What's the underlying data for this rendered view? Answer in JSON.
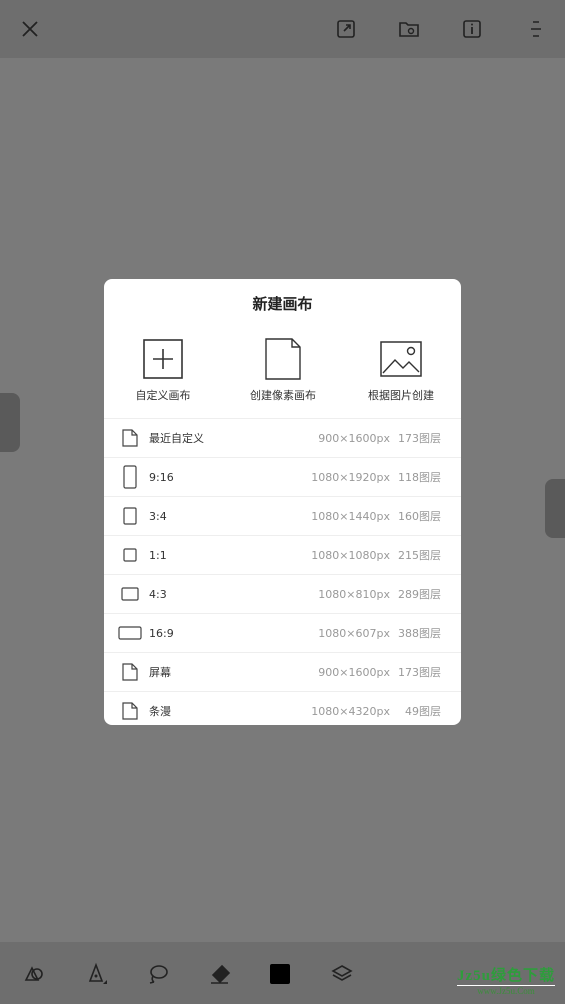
{
  "topbar": {
    "icons": [
      "close-icon",
      "export-icon",
      "gallery-folder-icon",
      "info-icon",
      "menu-icon"
    ]
  },
  "dialog": {
    "title": "新建画布",
    "options": [
      {
        "label": "自定义画布",
        "icon": "plus-canvas-icon"
      },
      {
        "label": "创建像素画布",
        "icon": "document-icon"
      },
      {
        "label": "根据图片创建",
        "icon": "image-icon"
      }
    ],
    "presets": [
      {
        "name": "最近自定义",
        "size": "900×1600px",
        "layers": "173图层",
        "icon": "document-icon"
      },
      {
        "name": "9:16",
        "size": "1080×1920px",
        "layers": "118图层",
        "icon": "portrait-9-16-icon"
      },
      {
        "name": "3:4",
        "size": "1080×1440px",
        "layers": "160图层",
        "icon": "portrait-3-4-icon"
      },
      {
        "name": "1:1",
        "size": "1080×1080px",
        "layers": "215图层",
        "icon": "square-icon"
      },
      {
        "name": "4:3",
        "size": "1080×810px",
        "layers": "289图层",
        "icon": "landscape-4-3-icon"
      },
      {
        "name": "16:9",
        "size": "1080×607px",
        "layers": "388图层",
        "icon": "landscape-16-9-icon"
      },
      {
        "name": "屏幕",
        "size": "900×1600px",
        "layers": "173图层",
        "icon": "document-icon"
      },
      {
        "name": "条漫",
        "size": "1080×4320px",
        "layers": "49图层",
        "icon": "document-icon"
      }
    ]
  },
  "bottombar": {
    "tools": [
      "shapes-icon",
      "pen-icon",
      "lasso-icon",
      "eraser-icon",
      "color-swatch-icon",
      "layers-icon"
    ],
    "color": "#000000"
  },
  "watermark": {
    "line1": "Jz5u绿色下载",
    "line2": "www.Jz5u.Com"
  }
}
